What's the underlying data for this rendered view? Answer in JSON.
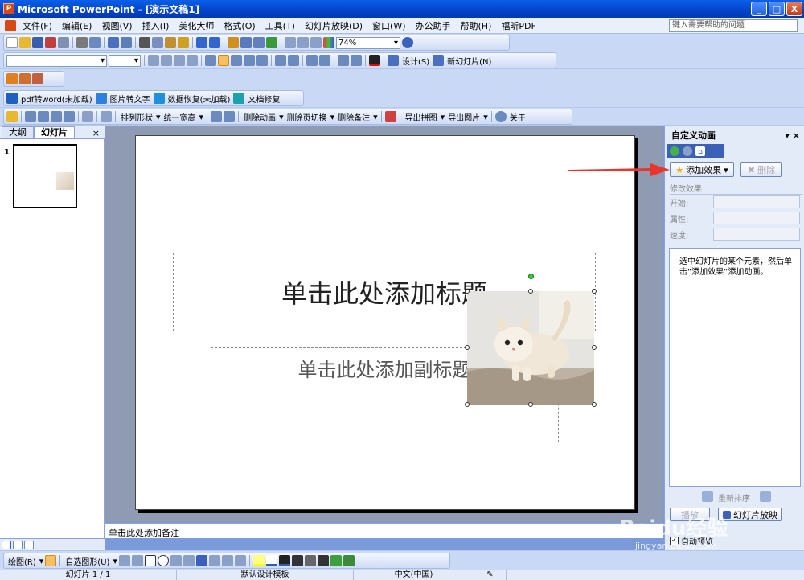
{
  "window": {
    "app_name": "Microsoft PowerPoint",
    "title": "Microsoft PowerPoint - [演示文稿1]",
    "minimize": "_",
    "maximize": "□",
    "close": "X"
  },
  "menubar": {
    "items": [
      "文件(F)",
      "编辑(E)",
      "视图(V)",
      "插入(I)",
      "美化大师",
      "格式(O)",
      "工具(T)",
      "幻灯片放映(D)",
      "窗口(W)",
      "办公助手",
      "帮助(H)",
      "福昕PDF"
    ],
    "help_placeholder": "键入需要帮助的问题"
  },
  "toolbar_standard": {
    "zoom": "74%"
  },
  "toolbar_format": {
    "design_label": "设计(S)",
    "new_slide_label": "新幻灯片(N)"
  },
  "toolbar_plugins": {
    "pdf_to_word": "pdf转word(未加载)",
    "image_to_text": "图片转文字",
    "data_recovery": "数据恢复(未加载)",
    "doc_repair": "文档修复"
  },
  "toolbar_tools": {
    "arrange_shapes": "排列形状",
    "uniform_size": "统一宽高",
    "remove_animation": "删除动画",
    "remove_transition": "删除页切换",
    "remove_notes": "删除备注",
    "export_collage": "导出拼图",
    "export_image": "导出图片",
    "about": "关于"
  },
  "left_pane": {
    "tab_outline": "大纲",
    "tab_slides": "幻灯片",
    "close": "×",
    "slide_number": "1"
  },
  "slide": {
    "title_placeholder": "单击此处添加标题",
    "subtitle_placeholder": "单击此处添加副标题"
  },
  "notes": {
    "placeholder": "单击此处添加备注"
  },
  "task_pane": {
    "title": "自定义动画",
    "add_effect": "添加效果",
    "remove": "删除",
    "modify_effect": "修改效果",
    "start_label": "开始:",
    "property_label": "属性:",
    "speed_label": "速度:",
    "hint": "选中幻灯片的某个元素，然后单击“添加效果”添加动画。",
    "reorder": "重新排序",
    "play": "播放",
    "slideshow": "幻灯片放映",
    "autopreview": "自动预览",
    "autopreview_checked": true
  },
  "drawing_toolbar": {
    "draw_label": "绘图(R)",
    "autoshapes_label": "自选图形(U)"
  },
  "statusbar": {
    "slide_pos": "幻灯片 1 / 1",
    "design_template": "默认设计模板",
    "language": "中文(中国)"
  },
  "watermark": {
    "brand": "Baidu经验",
    "url": "jingyan.baidu.com"
  },
  "colors": {
    "arrow": "#e8362d",
    "title_bar": "#0a5fe8",
    "xp_blue": "#c9d8f4"
  }
}
